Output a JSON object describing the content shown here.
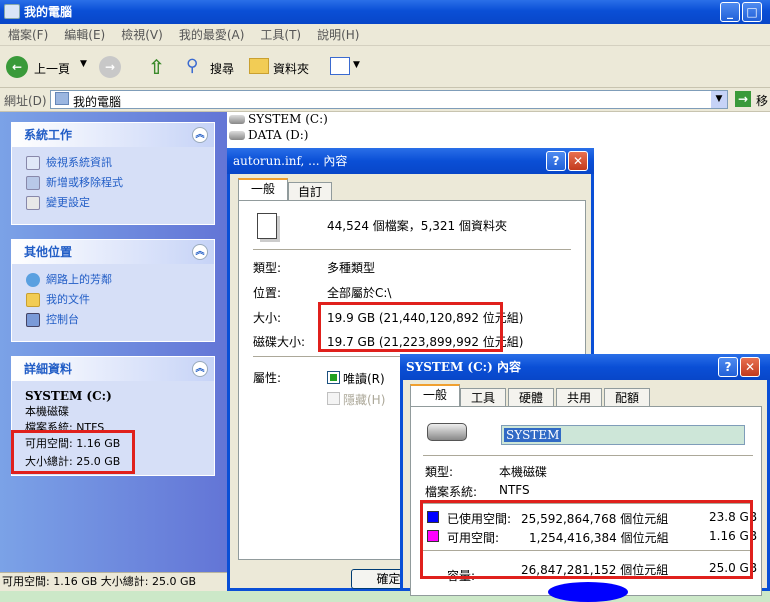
{
  "window": {
    "title": "我的電腦",
    "title_icon": "computer-icon"
  },
  "menu": [
    "檔案(F)",
    "編輯(E)",
    "檢視(V)",
    "我的最愛(A)",
    "工具(T)",
    "說明(H)"
  ],
  "toolbar": {
    "back": "上一頁",
    "search": "搜尋",
    "folders": "資料夾"
  },
  "address": {
    "label": "網址(D)",
    "value": "我的電腦",
    "go": "移"
  },
  "left": {
    "system_tasks": {
      "title": "系統工作",
      "items": [
        "檢視系統資訊",
        "新增或移除程式",
        "變更設定"
      ]
    },
    "other_places": {
      "title": "其他位置",
      "items": [
        "網路上的芳鄰",
        "我的文件",
        "控制台"
      ]
    },
    "details": {
      "title": "詳細資料",
      "name": "SYSTEM (C:)",
      "type": "本機磁碟",
      "fs": "檔案系統: NTFS",
      "free": "可用空間: 1.16 GB",
      "total": "大小總計: 25.0 GB"
    }
  },
  "drives": [
    "SYSTEM (C:)",
    "DATA (D:)"
  ],
  "status": "可用空間: 1.16 GB 大小總計: 25.0 GB",
  "dlg1": {
    "title": "autorun.inf, ... 內容",
    "tabs": [
      "一般",
      "自訂"
    ],
    "summary": "44,524 個檔案，5,321 個資料夾",
    "type_label": "類型:",
    "type_value": "多種類型",
    "loc_label": "位置:",
    "loc_value": "全部屬於C:\\",
    "size_label": "大小:",
    "size_value": "19.9 GB (21,440,120,892 位元組)",
    "disk_label": "磁碟大小:",
    "disk_value": "19.7 GB (21,223,899,992 位元組)",
    "attr_label": "屬性:",
    "readonly": "唯讀(R)",
    "hidden": "隱藏(H)",
    "ok": "確定"
  },
  "dlg2": {
    "title": "SYSTEM (C:) 內容",
    "tabs": [
      "一般",
      "工具",
      "硬體",
      "共用",
      "配額"
    ],
    "name": "SYSTEM",
    "type_label": "類型:",
    "type_value": "本機磁碟",
    "fs_label": "檔案系統:",
    "fs_value": "NTFS",
    "used_label": "已使用空間:",
    "used_bytes": "25,592,864,768 個位元組",
    "used_gb": "23.8 GB",
    "free_label": "可用空間:",
    "free_bytes": "1,254,416,384 個位元組",
    "free_gb": "1.16 GB",
    "cap_label": "容量:",
    "cap_bytes": "26,847,281,152 個位元組",
    "cap_gb": "25.0 GB",
    "used_color": "#0000ff",
    "free_color": "#ff00ff"
  }
}
